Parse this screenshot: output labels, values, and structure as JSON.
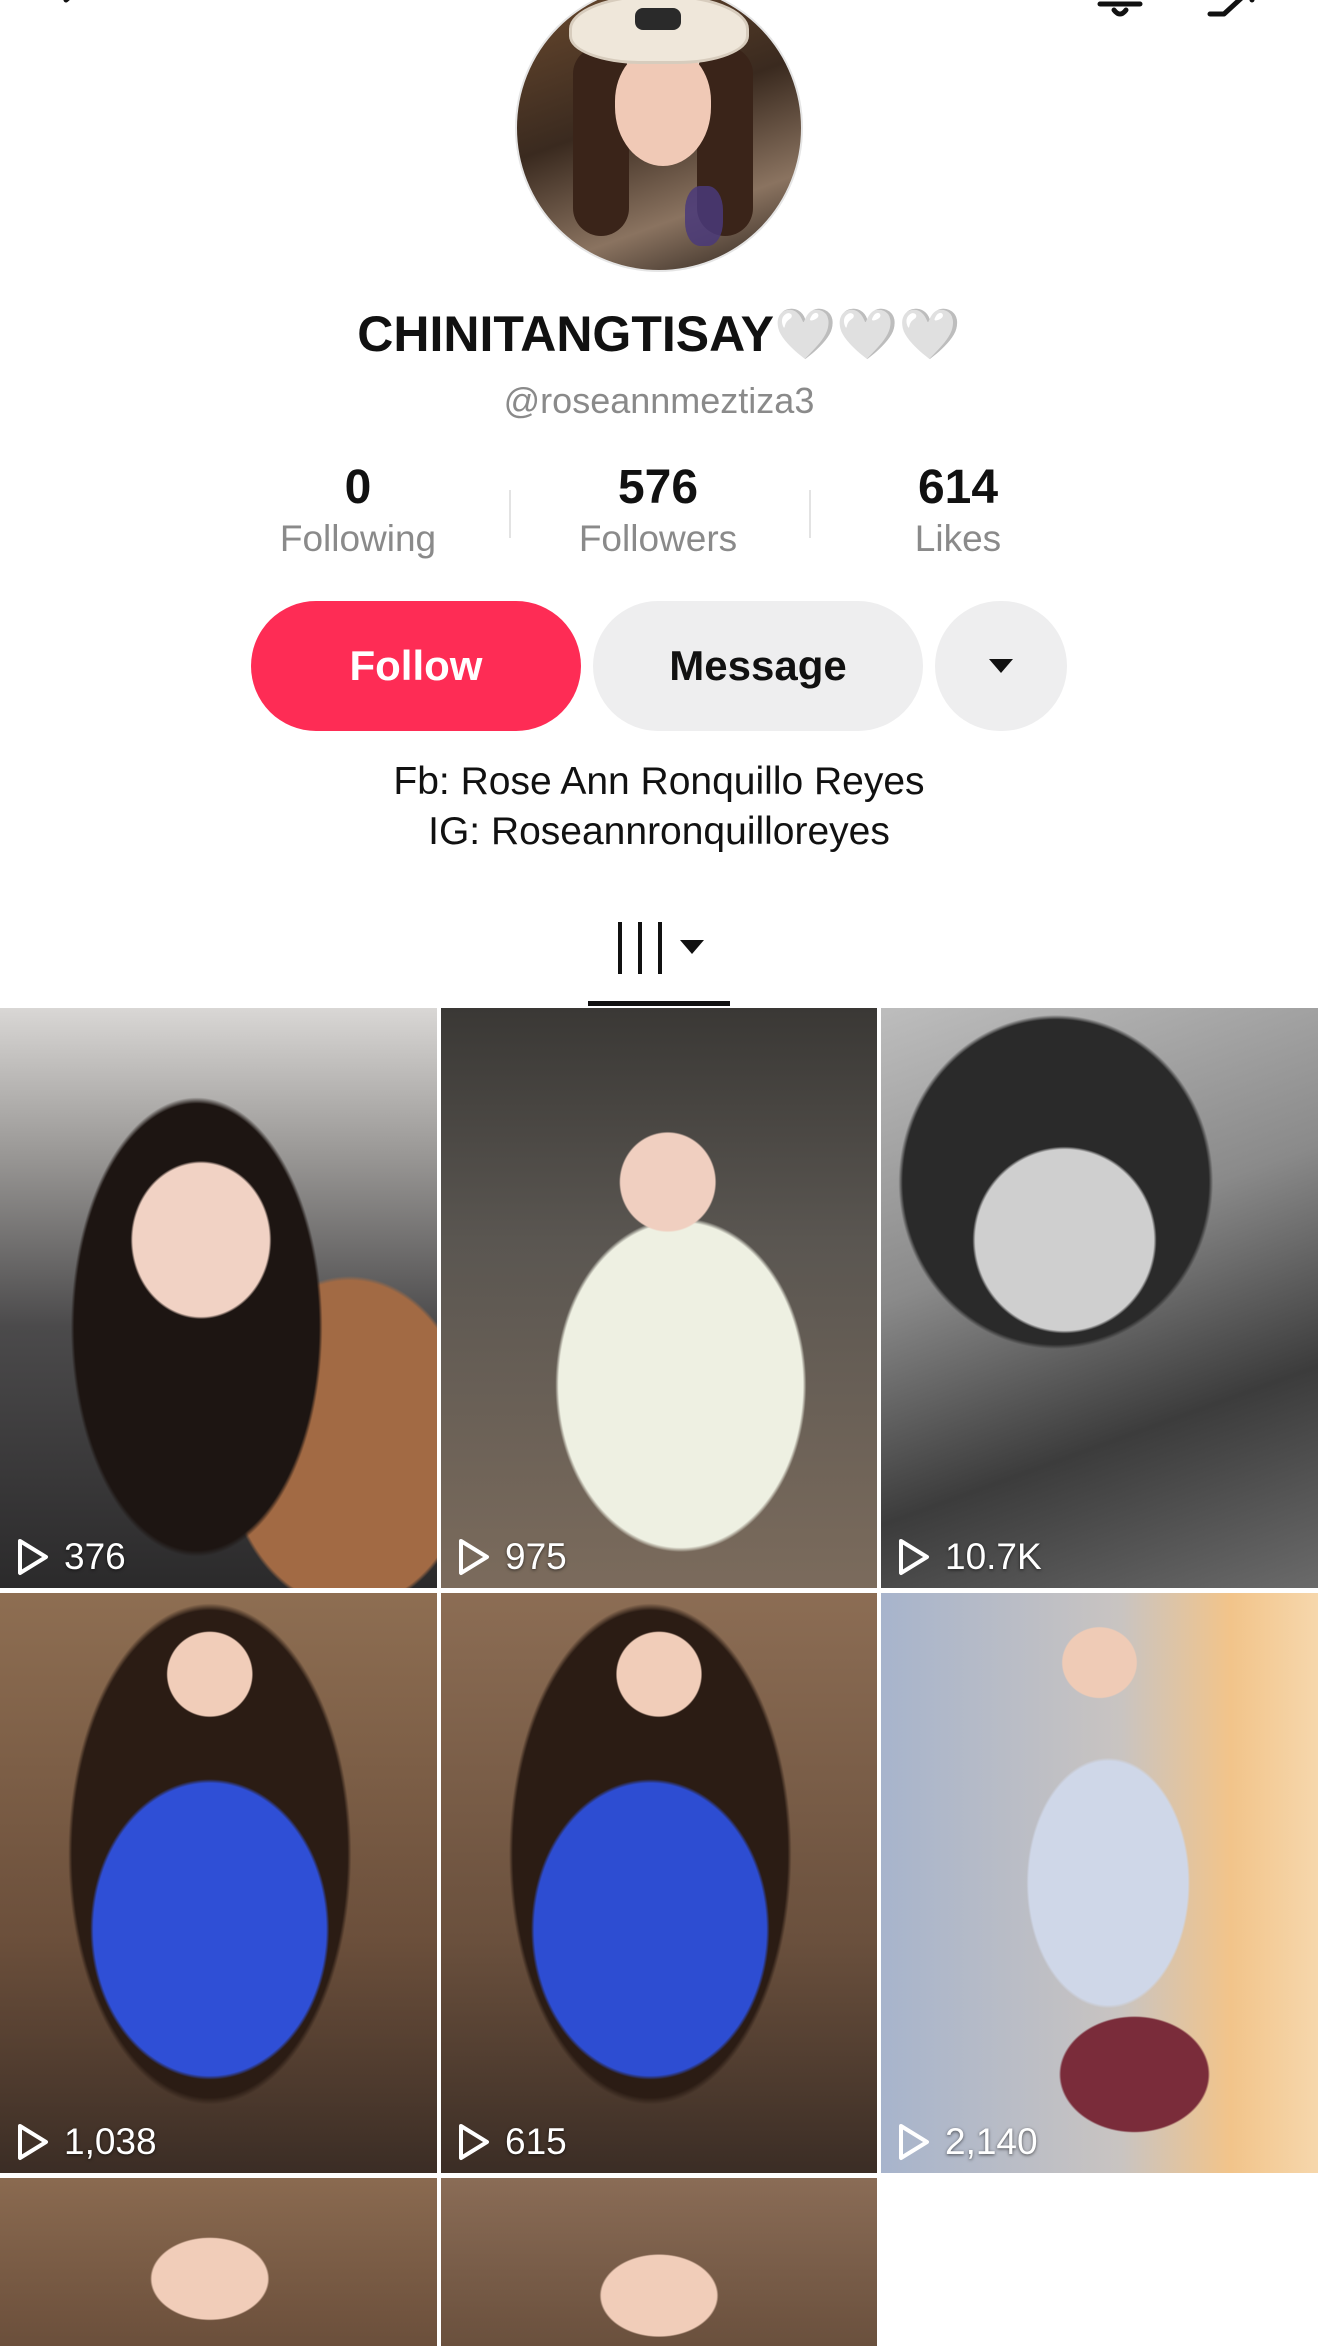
{
  "profile": {
    "display_name": "CHINITANGTISAY🤍🤍🤍",
    "handle": "@roseannmeztiza3"
  },
  "stats": {
    "following": {
      "value": "0",
      "label": "Following"
    },
    "followers": {
      "value": "576",
      "label": "Followers"
    },
    "likes": {
      "value": "614",
      "label": "Likes"
    }
  },
  "actions": {
    "follow_label": "Follow",
    "message_label": "Message"
  },
  "bio": {
    "line1": "Fb: Rose Ann Ronquillo Reyes",
    "line2": "IG: Roseannronquilloreyes"
  },
  "videos": [
    {
      "views": "376"
    },
    {
      "views": "975"
    },
    {
      "views": "10.7K"
    },
    {
      "views": "1,038"
    },
    {
      "views": "615"
    },
    {
      "views": "2,140"
    },
    {
      "views": ""
    },
    {
      "views": ""
    }
  ],
  "colors": {
    "follow_button": "#fe2c55",
    "secondary_button": "#eeeeef",
    "muted_text": "#8a8a8a"
  }
}
